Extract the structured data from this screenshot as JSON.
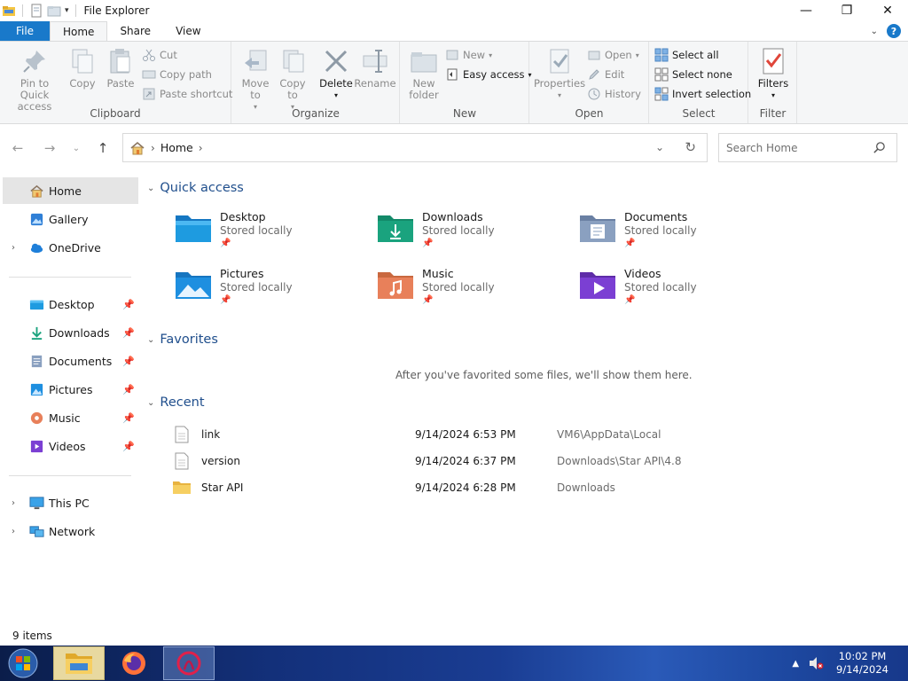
{
  "window": {
    "title": "File Explorer"
  },
  "tabs": [
    {
      "label": "File"
    },
    {
      "label": "Home"
    },
    {
      "label": "Share"
    },
    {
      "label": "View"
    }
  ],
  "ribbon": {
    "clipboard": {
      "label": "Clipboard",
      "pin": "Pin to Quick access",
      "copy": "Copy",
      "paste": "Paste",
      "cut": "Cut",
      "copy_path": "Copy path",
      "paste_shortcut": "Paste shortcut"
    },
    "organize": {
      "label": "Organize",
      "move_to": "Move to",
      "copy_to": "Copy to",
      "delete": "Delete",
      "rename": "Rename"
    },
    "new": {
      "label": "New",
      "new_folder": "New folder",
      "new_item": "New",
      "easy_access": "Easy access"
    },
    "open": {
      "label": "Open",
      "properties": "Properties",
      "open": "Open",
      "edit": "Edit",
      "history": "History"
    },
    "select": {
      "label": "Select",
      "select_all": "Select all",
      "select_none": "Select none",
      "invert_selection": "Invert selection"
    },
    "filter": {
      "label": "Filter",
      "filters": "Filters"
    }
  },
  "address": {
    "crumb": "Home"
  },
  "search": {
    "placeholder": "Search Home"
  },
  "sidebar": {
    "top": [
      {
        "label": "Home",
        "icon": "home-icon"
      },
      {
        "label": "Gallery",
        "icon": "gallery-icon"
      },
      {
        "label": "OneDrive",
        "icon": "onedrive-icon"
      }
    ],
    "pinned": [
      {
        "label": "Desktop",
        "icon": "desktop-folder-icon"
      },
      {
        "label": "Downloads",
        "icon": "download-icon"
      },
      {
        "label": "Documents",
        "icon": "documents-icon"
      },
      {
        "label": "Pictures",
        "icon": "pictures-icon"
      },
      {
        "label": "Music",
        "icon": "music-icon"
      },
      {
        "label": "Videos",
        "icon": "videos-icon"
      }
    ],
    "bottom": [
      {
        "label": "This PC",
        "icon": "this-pc-icon"
      },
      {
        "label": "Network",
        "icon": "network-icon"
      }
    ]
  },
  "content": {
    "quick_access": {
      "heading": "Quick access",
      "items": [
        {
          "name": "Desktop",
          "sub": "Stored locally",
          "color": "#1e9be0"
        },
        {
          "name": "Downloads",
          "sub": "Stored locally",
          "color": "#1aa37e"
        },
        {
          "name": "Documents",
          "sub": "Stored locally",
          "color": "#7f95b8"
        },
        {
          "name": "Pictures",
          "sub": "Stored locally",
          "color": "#1e8fe0"
        },
        {
          "name": "Music",
          "sub": "Stored locally",
          "color": "#e8805a"
        },
        {
          "name": "Videos",
          "sub": "Stored locally",
          "color": "#7b3fd3"
        }
      ]
    },
    "favorites": {
      "heading": "Favorites",
      "empty_message": "After you've favorited some files, we'll show them here."
    },
    "recent": {
      "heading": "Recent",
      "items": [
        {
          "name": "link",
          "date": "9/14/2024 6:53 PM",
          "location": "VM6\\AppData\\Local",
          "type": "file"
        },
        {
          "name": "version",
          "date": "9/14/2024 6:37 PM",
          "location": "Downloads\\Star API\\4.8",
          "type": "file"
        },
        {
          "name": "Star API",
          "date": "9/14/2024 6:28 PM",
          "location": "Downloads",
          "type": "folder"
        }
      ]
    }
  },
  "status": {
    "item_count": "9 items"
  },
  "taskbar": {
    "time": "10:02 PM",
    "date": "9/14/2024"
  }
}
